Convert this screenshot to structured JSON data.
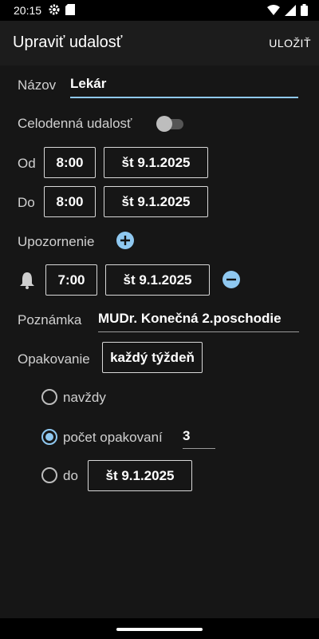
{
  "status_bar": {
    "time": "20:15",
    "icons": [
      "gear-icon",
      "sd-card-icon",
      "wifi-icon",
      "signal-icon",
      "battery-icon"
    ]
  },
  "app_bar": {
    "title": "Upraviť udalosť",
    "save_label": "ULOŽIŤ"
  },
  "form": {
    "name_label": "Názov",
    "name_value": "Lekár",
    "all_day_label": "Celodenná udalosť",
    "all_day_on": false,
    "from_label": "Od",
    "from_time": "8:00",
    "from_date": "št 9.1.2025",
    "to_label": "Do",
    "to_time": "8:00",
    "to_date": "št 9.1.2025",
    "reminder_label": "Upozornenie",
    "reminder_time": "7:00",
    "reminder_date": "št 9.1.2025",
    "note_label": "Poznámka",
    "note_value": "MUDr. Konečná 2.poschodie",
    "repeat_label": "Opakovanie",
    "repeat_value": "každý týždeň",
    "repeat_options": {
      "forever_label": "navždy",
      "count_label": "počet opakovaní",
      "count_value": "3",
      "until_label": "do",
      "until_date": "št 9.1.2025",
      "selected": "count"
    }
  },
  "colors": {
    "accent": "#8fc8f0",
    "background": "#161616",
    "appbar": "#1c1c1c"
  }
}
